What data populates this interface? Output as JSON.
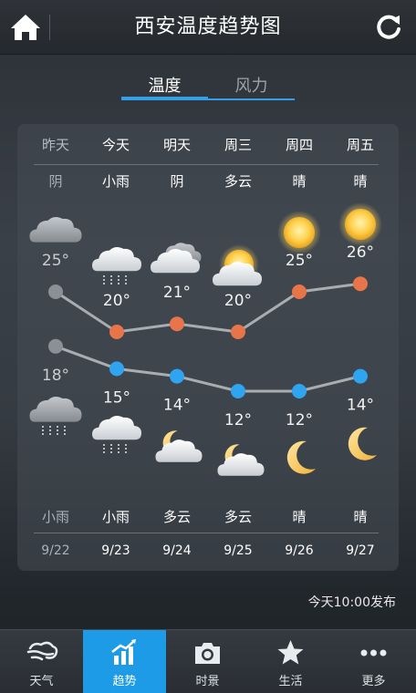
{
  "header": {
    "title": "西安温度趋势图"
  },
  "tabs": [
    {
      "label": "温度",
      "active": true
    },
    {
      "label": "风力",
      "active": false
    }
  ],
  "days": [
    {
      "day": "昨天",
      "day_cond": "阴",
      "high": "25°",
      "low": "18°",
      "night_cond": "小雨",
      "date": "9/22",
      "day_icon": "cloudy-icon",
      "night_icon": "rain-icon"
    },
    {
      "day": "今天",
      "day_cond": "小雨",
      "high": "20°",
      "low": "15°",
      "night_cond": "小雨",
      "date": "9/23",
      "day_icon": "rain-icon",
      "night_icon": "rain-icon"
    },
    {
      "day": "明天",
      "day_cond": "阴",
      "high": "21°",
      "low": "14°",
      "night_cond": "多云",
      "date": "9/24",
      "day_icon": "cloudy-icon",
      "night_icon": "moon-cloud-icon"
    },
    {
      "day": "周三",
      "day_cond": "多云",
      "high": "20°",
      "low": "12°",
      "night_cond": "多云",
      "date": "9/25",
      "day_icon": "sun-cloud-icon",
      "night_icon": "moon-cloud-icon"
    },
    {
      "day": "周四",
      "day_cond": "晴",
      "high": "25°",
      "low": "12°",
      "night_cond": "晴",
      "date": "9/26",
      "day_icon": "sun-icon",
      "night_icon": "moon-icon"
    },
    {
      "day": "周五",
      "day_cond": "晴",
      "high": "26°",
      "low": "14°",
      "night_cond": "晴",
      "date": "9/27",
      "day_icon": "sun-icon",
      "night_icon": "moon-icon"
    }
  ],
  "chart_data": {
    "type": "line",
    "categories": [
      "昨天",
      "今天",
      "明天",
      "周三",
      "周四",
      "周五"
    ],
    "series": [
      {
        "values": [
          25,
          20,
          21,
          20,
          25,
          26
        ],
        "color": "#e8744a"
      },
      {
        "values": [
          18,
          15,
          14,
          12,
          12,
          14
        ],
        "color": "#2fa4f0"
      }
    ],
    "past_point_color": "#8a9096",
    "line_color": "#a8adb2"
  },
  "publish_text": "今天10:00发布",
  "nav": [
    {
      "label": "天气",
      "icon": "weather-icon",
      "active": false
    },
    {
      "label": "趋势",
      "icon": "trend-icon",
      "active": true
    },
    {
      "label": "时景",
      "icon": "camera-icon",
      "active": false
    },
    {
      "label": "生活",
      "icon": "star-icon",
      "active": false
    },
    {
      "label": "更多",
      "icon": "more-icon",
      "active": false
    }
  ],
  "colors": {
    "accent": "#1e9be6",
    "high": "#e8744a",
    "low": "#2fa4f0"
  }
}
